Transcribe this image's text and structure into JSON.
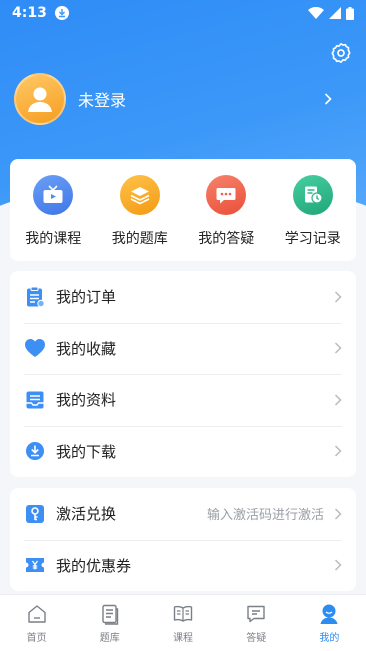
{
  "status": {
    "time": "4:13"
  },
  "profile": {
    "login_text": "未登录"
  },
  "quick_actions": [
    {
      "label": "我的课程",
      "icon": "tv-icon",
      "color": "#4f8cf0"
    },
    {
      "label": "我的题库",
      "icon": "layers-icon",
      "color": "#f5a623"
    },
    {
      "label": "我的答疑",
      "icon": "chat-icon",
      "color": "#f0614b"
    },
    {
      "label": "学习记录",
      "icon": "history-icon",
      "color": "#2fb58a"
    }
  ],
  "menu": [
    {
      "label": "我的订单",
      "icon": "order-clipboard-icon"
    },
    {
      "label": "我的收藏",
      "icon": "heart-icon"
    },
    {
      "label": "我的资料",
      "icon": "document-tray-icon"
    },
    {
      "label": "我的下载",
      "icon": "download-icon"
    }
  ],
  "menu2": [
    {
      "label": "激活兑换",
      "icon": "key-icon",
      "hint": "输入激活码进行激活"
    },
    {
      "label": "我的优惠券",
      "icon": "coupon-icon"
    }
  ],
  "tabs": [
    {
      "label": "首页",
      "icon": "home-icon"
    },
    {
      "label": "题库",
      "icon": "question-bank-icon"
    },
    {
      "label": "课程",
      "icon": "book-icon"
    },
    {
      "label": "答疑",
      "icon": "message-icon"
    },
    {
      "label": "我的",
      "icon": "user-icon",
      "active": true
    }
  ],
  "colors": {
    "accent": "#2d8cf0",
    "hero": "#3c98f8"
  }
}
